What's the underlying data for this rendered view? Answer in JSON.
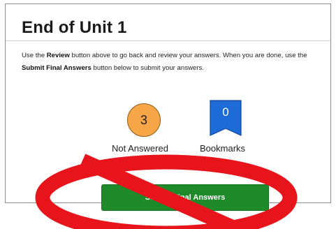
{
  "title": "End of Unit 1",
  "instructions": {
    "part1": "Use the ",
    "review": "Review",
    "part2": " button above to go back and review your answers. When you are done, use the ",
    "submit_final": "Submit Final Answers",
    "part3": " button below to submit your answers."
  },
  "status": {
    "not_answered_count": "3",
    "not_answered_label": "Not Answered",
    "bookmarks_count": "0",
    "bookmarks_label": "Bookmarks"
  },
  "submit_button_label": "Submit Final Answers",
  "icons": {
    "not_answered": "circle-count-icon",
    "bookmarks": "bookmark-ribbon-icon",
    "overlay": "prohibition-sign-icon"
  },
  "colors": {
    "not_answered_fill": "#f6a646",
    "bookmark_fill": "#1d6bd6",
    "submit_button": "#1f8a2a",
    "prohibition_red": "#e8141b"
  }
}
